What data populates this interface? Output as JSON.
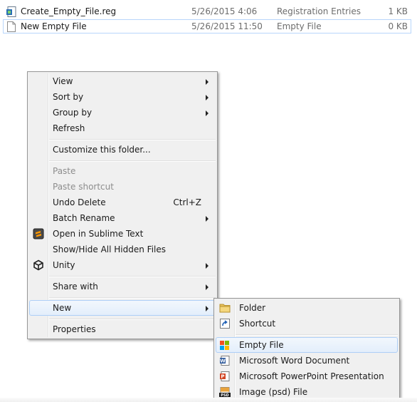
{
  "files": [
    {
      "name": "Create_Empty_File.reg",
      "date": "5/26/2015 4:06",
      "type": "Registration Entries",
      "size": "1 KB",
      "icon": "reg-file-icon"
    },
    {
      "name": "New Empty File",
      "date": "5/26/2015 11:50",
      "type": "Empty File",
      "size": "0 KB",
      "icon": "blank-file-icon"
    }
  ],
  "context_menu": {
    "view": "View",
    "sort_by": "Sort by",
    "group_by": "Group by",
    "refresh": "Refresh",
    "customize": "Customize this folder...",
    "paste": "Paste",
    "paste_shortcut": "Paste shortcut",
    "undo_delete": "Undo Delete",
    "undo_delete_shortcut": "Ctrl+Z",
    "batch_rename": "Batch Rename",
    "open_sublime": "Open in Sublime Text",
    "show_hide": "Show/Hide All Hidden Files",
    "unity": "Unity",
    "share_with": "Share with",
    "new": "New",
    "properties": "Properties"
  },
  "new_submenu": {
    "folder": "Folder",
    "shortcut": "Shortcut",
    "empty_file": "Empty File",
    "word_doc": "Microsoft Word Document",
    "ppt": "Microsoft PowerPoint Presentation",
    "psd": "Image (psd) File"
  },
  "colors": {
    "highlight_border": "#aecff7",
    "menu_background": "#f0f0f0",
    "selection_border": "#b8d6fb"
  }
}
